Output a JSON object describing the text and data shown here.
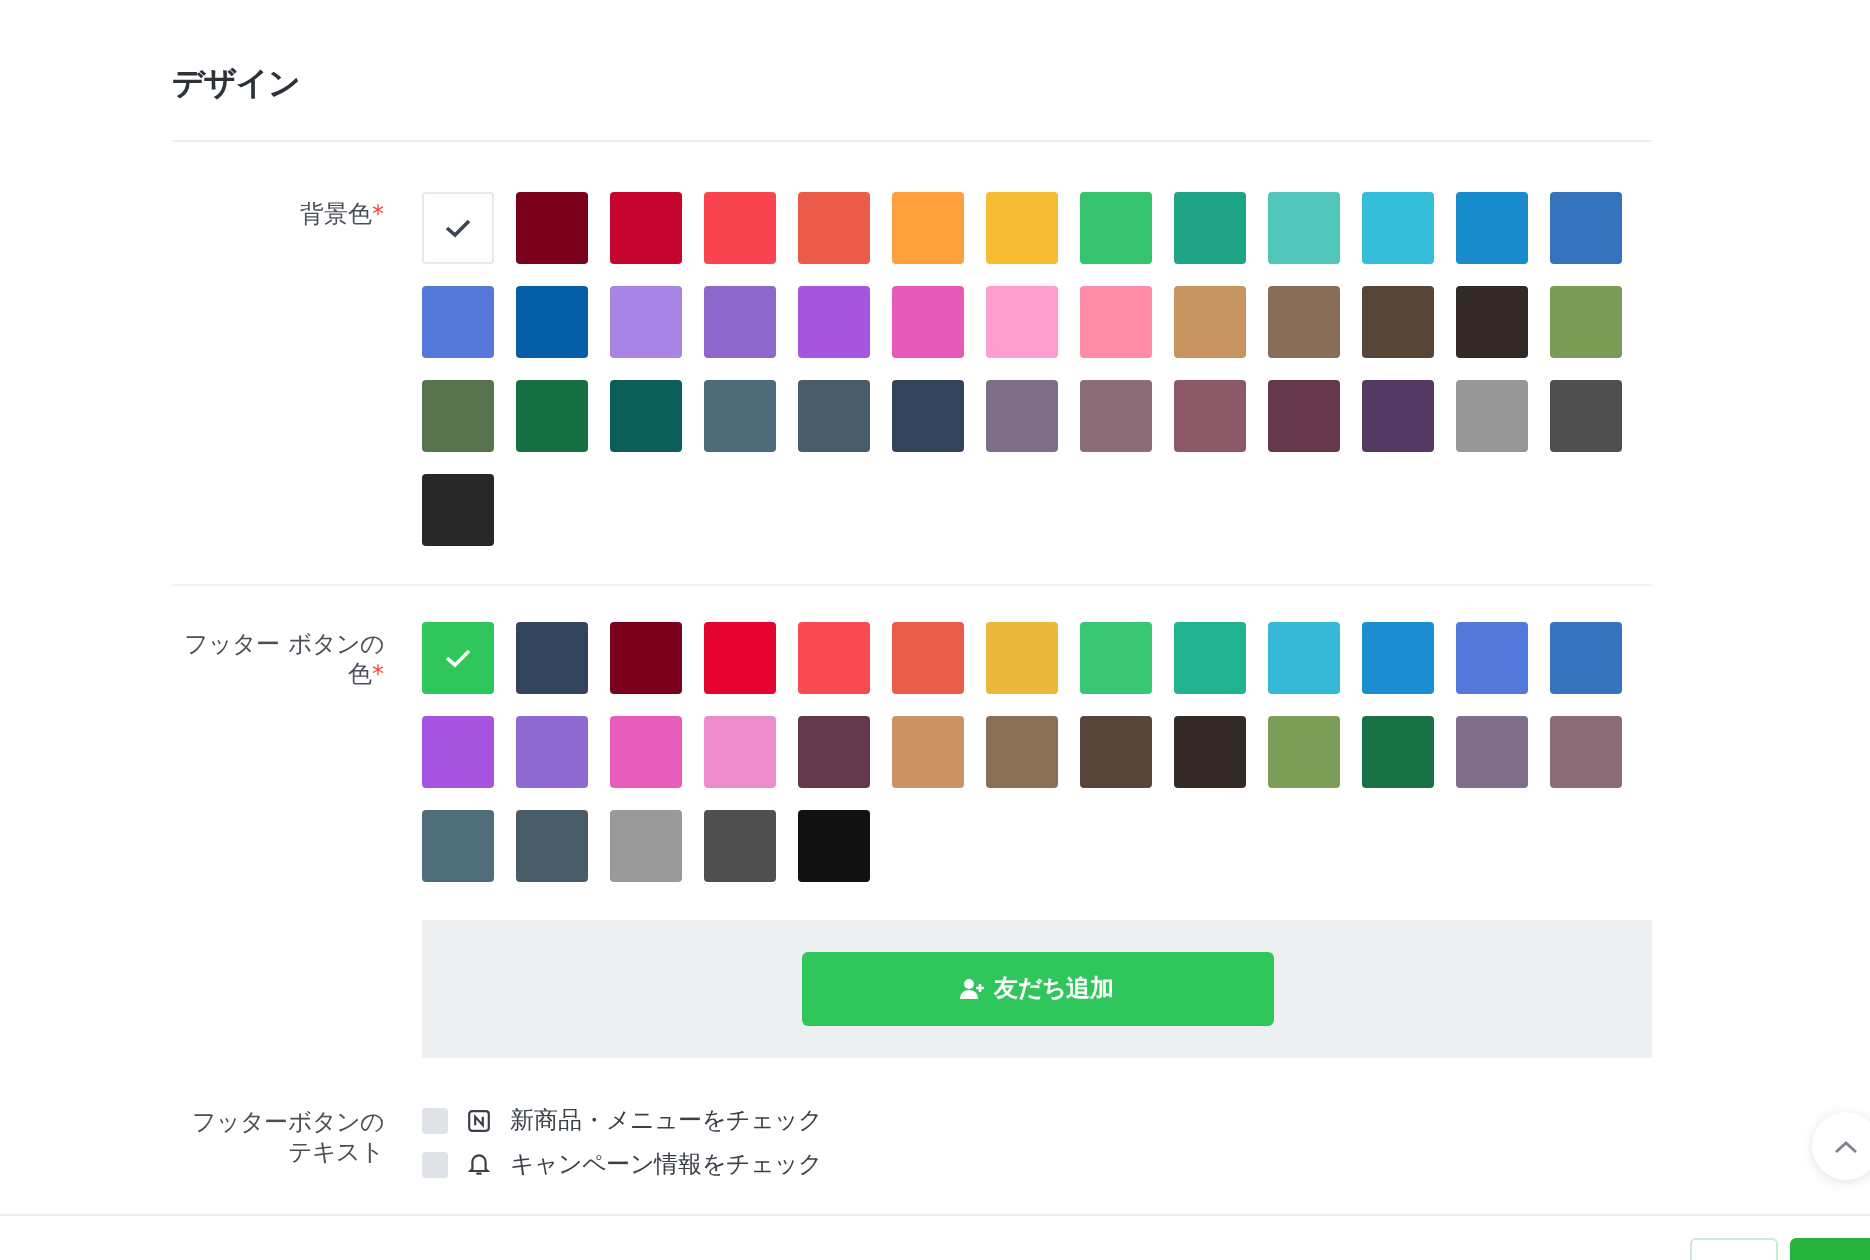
{
  "section": {
    "title": "デザイン"
  },
  "background_color": {
    "label": "背景色",
    "required_mark": "*",
    "swatches": [
      {
        "color": "#ffffff",
        "selected": true
      },
      {
        "color": "#7a001c",
        "selected": false
      },
      {
        "color": "#c5052e",
        "selected": false
      },
      {
        "color": "#f9444f",
        "selected": false
      },
      {
        "color": "#ea5b4a",
        "selected": false
      },
      {
        "color": "#fd9f3c",
        "selected": false
      },
      {
        "color": "#f6bd34",
        "selected": false
      },
      {
        "color": "#37c471",
        "selected": false
      },
      {
        "color": "#1fa586",
        "selected": false
      },
      {
        "color": "#4fc6b8",
        "selected": false
      },
      {
        "color": "#35bed9",
        "selected": false
      },
      {
        "color": "#178bcc",
        "selected": false
      },
      {
        "color": "#3673bd",
        "selected": false
      },
      {
        "color": "#5479da",
        "selected": false
      },
      {
        "color": "#045fa6",
        "selected": false
      },
      {
        "color": "#a784e5",
        "selected": false
      },
      {
        "color": "#8d67cc",
        "selected": false
      },
      {
        "color": "#a555df",
        "selected": false
      },
      {
        "color": "#e659b8",
        "selected": false
      },
      {
        "color": "#fd9ecf",
        "selected": false
      },
      {
        "color": "#fd8ba6",
        "selected": false
      },
      {
        "color": "#c79462",
        "selected": false
      },
      {
        "color": "#886e56",
        "selected": false
      },
      {
        "color": "#57453a",
        "selected": false
      },
      {
        "color": "#332a25",
        "selected": false
      },
      {
        "color": "#7b9c56",
        "selected": false
      },
      {
        "color": "#58744f",
        "selected": false
      },
      {
        "color": "#167142",
        "selected": false
      },
      {
        "color": "#0b5e5a",
        "selected": false
      },
      {
        "color": "#4e6b79",
        "selected": false
      },
      {
        "color": "#4a5c69",
        "selected": false
      },
      {
        "color": "#34435e",
        "selected": false
      },
      {
        "color": "#7d6e88",
        "selected": false
      },
      {
        "color": "#886d76",
        "selected": false
      },
      {
        "color": "#8b5868",
        "selected": false
      },
      {
        "color": "#65384d",
        "selected": false
      },
      {
        "color": "#533963",
        "selected": false
      },
      {
        "color": "#979797",
        "selected": false
      },
      {
        "color": "#4f4f4f",
        "selected": false
      },
      {
        "color": "#272727",
        "selected": false
      }
    ]
  },
  "footer_button_color": {
    "label": "フッター ボタンの色",
    "required_mark": "*",
    "swatches": [
      {
        "color": "#2fc65c",
        "selected": true
      },
      {
        "color": "#34445e",
        "selected": false
      },
      {
        "color": "#7a001c",
        "selected": false
      },
      {
        "color": "#e5032f",
        "selected": false
      },
      {
        "color": "#f94a52",
        "selected": false
      },
      {
        "color": "#ea5d4b",
        "selected": false
      },
      {
        "color": "#eab93c",
        "selected": false
      },
      {
        "color": "#38c674",
        "selected": false
      },
      {
        "color": "#21b290",
        "selected": false
      },
      {
        "color": "#35b9d6",
        "selected": false
      },
      {
        "color": "#1a8ed1",
        "selected": false
      },
      {
        "color": "#5478d9",
        "selected": false
      },
      {
        "color": "#3575c0",
        "selected": false
      },
      {
        "color": "#a554e0",
        "selected": false
      },
      {
        "color": "#8e69cf",
        "selected": false
      },
      {
        "color": "#e85cbc",
        "selected": false
      },
      {
        "color": "#ec8ccb",
        "selected": false
      },
      {
        "color": "#64384c",
        "selected": false
      },
      {
        "color": "#c99461",
        "selected": false
      },
      {
        "color": "#8a6e55",
        "selected": false
      },
      {
        "color": "#574539",
        "selected": false
      },
      {
        "color": "#342a25",
        "selected": false
      },
      {
        "color": "#7b9d57",
        "selected": false
      },
      {
        "color": "#177346",
        "selected": false
      },
      {
        "color": "#7e6e89",
        "selected": false
      },
      {
        "color": "#8a6d76",
        "selected": false
      },
      {
        "color": "#4f6e7c",
        "selected": false
      },
      {
        "color": "#495c67",
        "selected": false
      },
      {
        "color": "#9a9a9a",
        "selected": false
      },
      {
        "color": "#4f4f4f",
        "selected": false
      },
      {
        "color": "#121212",
        "selected": false
      }
    ],
    "preview_button": {
      "label": "友だち追加"
    }
  },
  "footer_button_text": {
    "label": "フッターボタンのテキスト",
    "options": [
      {
        "kind": "news",
        "label": "新商品・メニューをチェック",
        "checked": false
      },
      {
        "kind": "campaign",
        "label": "キャンペーン情報をチェック",
        "checked": false
      }
    ]
  }
}
